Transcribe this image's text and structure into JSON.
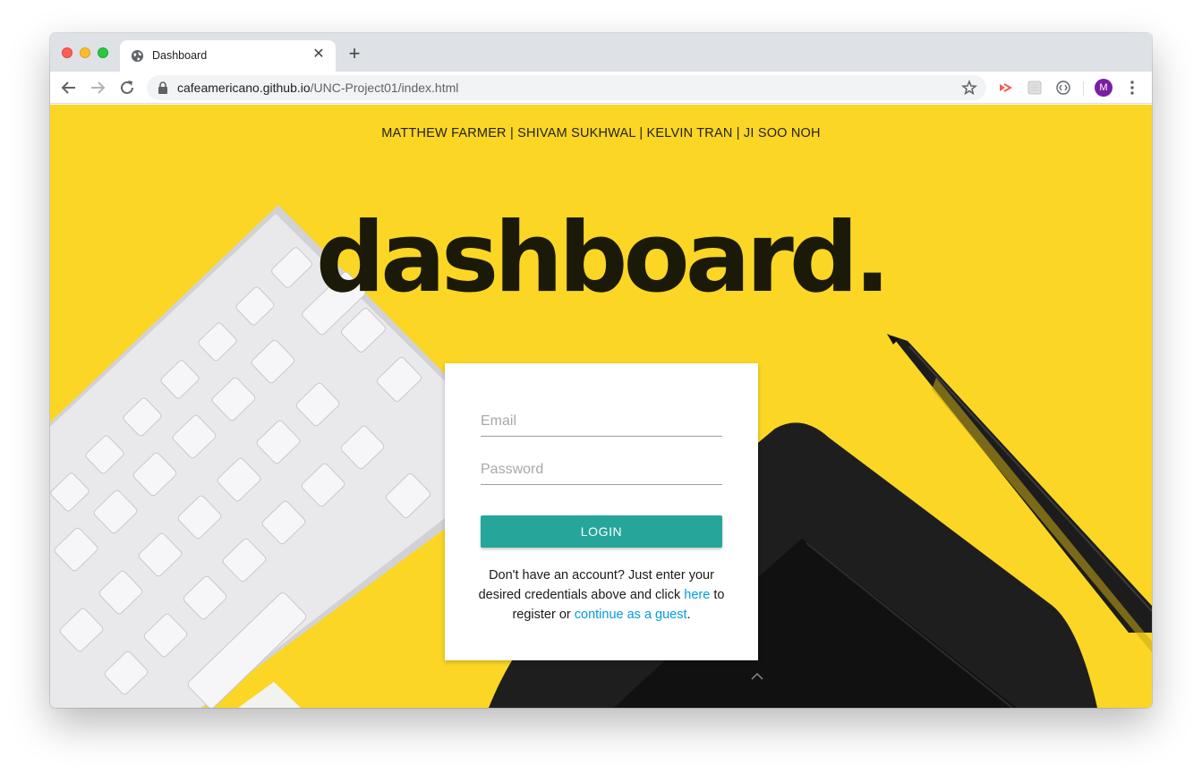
{
  "browser": {
    "tab": {
      "title": "Dashboard",
      "favicon": "globe-icon",
      "close_icon": "close-icon"
    },
    "new_tab_icon": "plus-icon",
    "address": {
      "host": "cafeamericano.github.io",
      "path": "/UNC-Project01/index.html",
      "lock_icon": "lock-icon"
    },
    "profile_initial": "M",
    "profile_color": "#7b1fa2"
  },
  "page": {
    "authors": "MATTHEW FARMER | SHIVAM SUKHWAL | KELVIN TRAN | JI SOO NOH",
    "hero_title": "dashboard.",
    "background_color": "#fbd624",
    "login": {
      "email_placeholder": "Email",
      "password_placeholder": "Password",
      "button_label": "LOGIN",
      "button_color": "#26a69a",
      "signup_text_1": "Don't have an account? Just enter your desired credentials above and click ",
      "register_link": "here",
      "signup_text_2": " to register or ",
      "guest_link": "continue as a guest",
      "signup_text_3": ".",
      "link_color": "#039be5"
    }
  }
}
